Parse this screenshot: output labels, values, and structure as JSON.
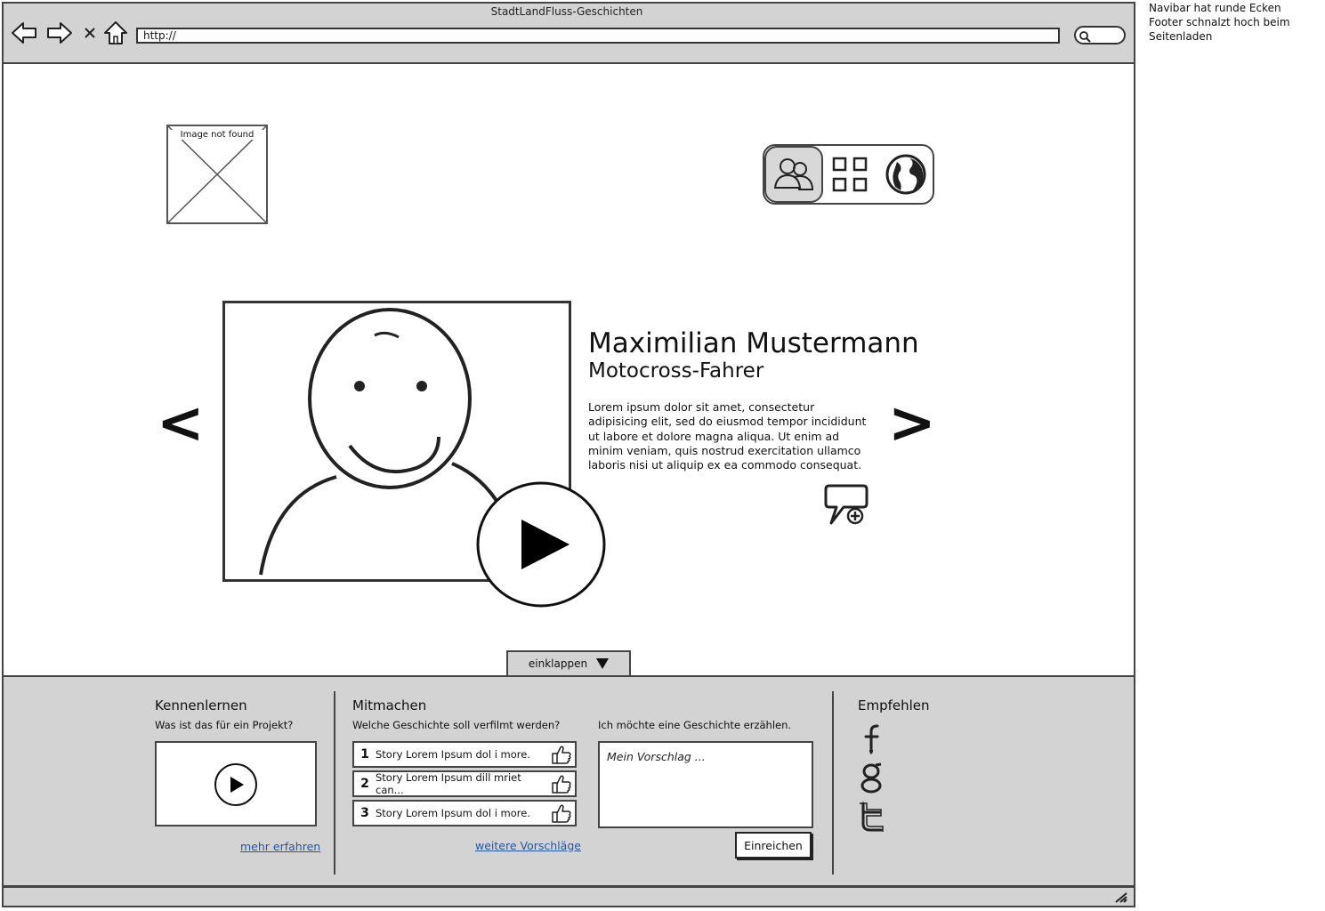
{
  "browser": {
    "title": "StadtLandFluss-Geschichten",
    "url": "http://"
  },
  "note": "Navibar hat runde Ecken\nFooter schnalzt hoch beim Seitenladen",
  "logo": {
    "placeholder_text": "Image not found"
  },
  "navibar": {
    "items": [
      "people-icon",
      "grid-icon",
      "globe-icon"
    ]
  },
  "slider": {
    "prev_label": "<",
    "next_label": ">",
    "name": "Maximilian Mustermann",
    "role": "Motocross-Fahrer",
    "description": "Lorem ipsum dolor sit amet, consectetur adipisicing elit, sed do eiusmod tempor incididunt ut labore et dolore magna aliqua. Ut enim ad minim veniam, quis nostrud exercitation ullamco laboris nisi ut aliquip ex ea commodo consequat."
  },
  "collapse": {
    "label": "einklappen"
  },
  "footer": {
    "kennenlernen": {
      "title": "Kennenlernen",
      "subtitle": "Was ist das für ein Projekt?",
      "link": "mehr erfahren"
    },
    "mitmachen": {
      "title": "Mitmachen",
      "subtitle": "Welche Geschichte soll verfilmt werden?",
      "stories": [
        {
          "num": "1",
          "text": "Story Lorem Ipsum dol i more."
        },
        {
          "num": "2",
          "text": "Story Lorem Ipsum dill mriet can..."
        },
        {
          "num": "3",
          "text": "Story Lorem Ipsum dol i more."
        }
      ],
      "link": "weitere Vorschläge",
      "erzaehlen_label": "Ich möchte eine Geschichte erzählen.",
      "input_placeholder": "Mein Vorschlag ...",
      "submit": "Einreichen"
    },
    "empfehlen": {
      "title": "Empfehlen",
      "icons": [
        "facebook-icon",
        "google-icon",
        "twitter-icon"
      ]
    }
  }
}
